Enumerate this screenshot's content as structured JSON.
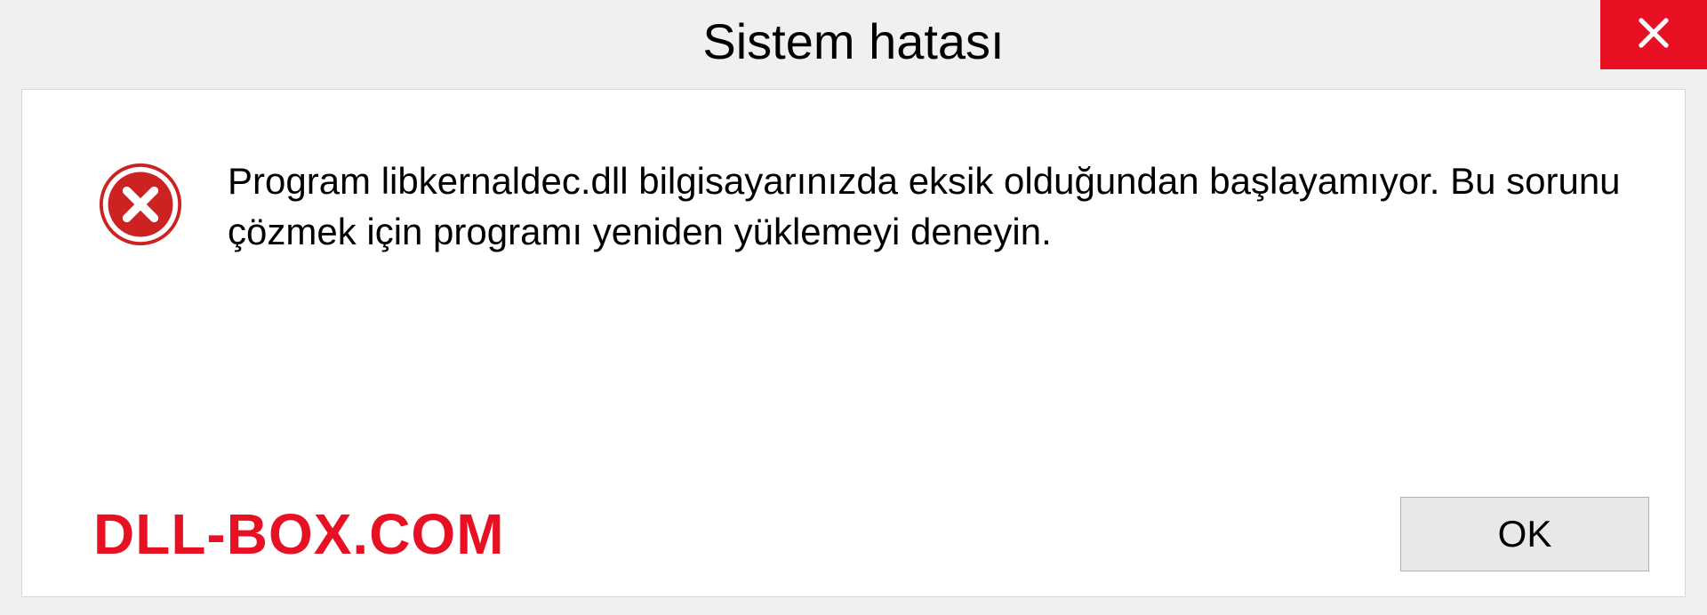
{
  "dialog": {
    "title": "Sistem hatası",
    "message": "Program libkernaldec.dll bilgisayarınızda eksik olduğundan başlayamıyor. Bu sorunu çözmek için programı yeniden yüklemeyi deneyin.",
    "ok_label": "OK"
  },
  "watermark": "DLL-BOX.COM"
}
